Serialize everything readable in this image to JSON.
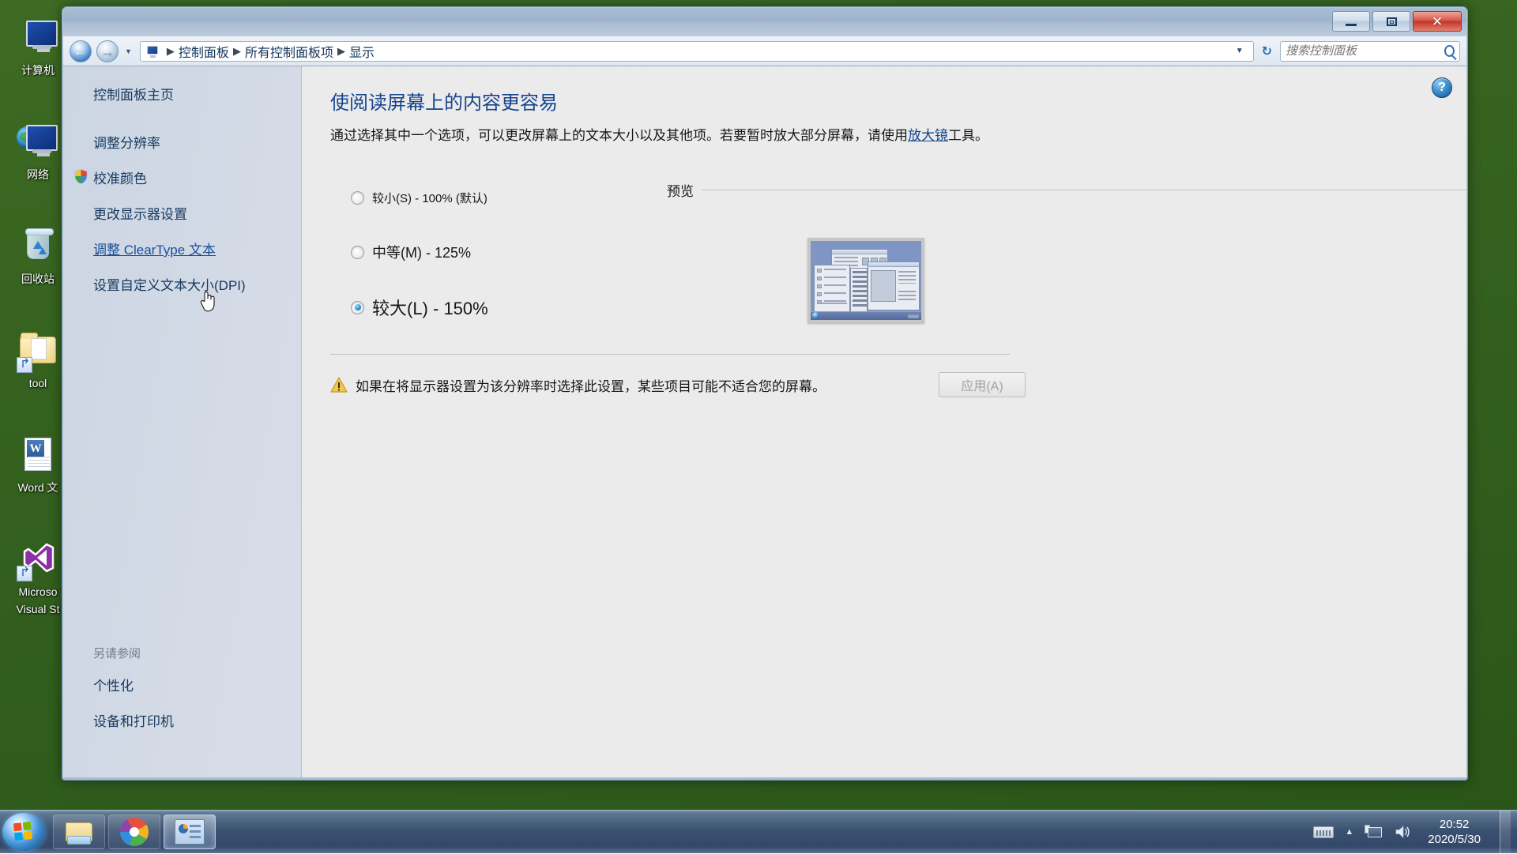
{
  "desktop": {
    "icons": [
      {
        "label": "计算机",
        "icon": "computer-icon"
      },
      {
        "label": "网络",
        "icon": "network-icon"
      },
      {
        "label": "回收站",
        "icon": "recycle-bin-icon"
      },
      {
        "label": "tool",
        "icon": "folder-shortcut-icon"
      },
      {
        "label": "Word 文",
        "icon": "word-document-icon"
      },
      {
        "label": "Microso",
        "label2": "Visual St",
        "icon": "visual-studio-icon"
      }
    ]
  },
  "window": {
    "nav": {
      "back_label": "←",
      "forward_label": "→",
      "history_dropdown": "▼",
      "breadcrumb": [
        "控制面板",
        "所有控制面板项",
        "显示"
      ],
      "breadcrumb_separator": "▶",
      "breadcrumb_dropdown": "▼",
      "refresh_label": "↻",
      "computer_icon": "computer-small-icon"
    },
    "search": {
      "placeholder": "搜索控制面板",
      "value": ""
    },
    "buttons": {
      "minimize": "—",
      "maximize": "❐",
      "close": "✕"
    },
    "help_label": "?"
  },
  "sidebar": {
    "home": "控制面板主页",
    "links": [
      {
        "label": "调整分辨率",
        "shield": false,
        "hovered": false
      },
      {
        "label": "校准颜色",
        "shield": true,
        "hovered": false
      },
      {
        "label": "更改显示器设置",
        "shield": false,
        "hovered": false
      },
      {
        "label": "调整 ClearType 文本",
        "shield": false,
        "hovered": true
      },
      {
        "label": "设置自定义文本大小(DPI)",
        "shield": false,
        "hovered": false
      }
    ],
    "see_also_title": "另请参阅",
    "see_also": [
      "个性化",
      "设备和打印机"
    ]
  },
  "content": {
    "title": "使阅读屏幕上的内容更容易",
    "desc_part1": "通过选择其中一个选项，可以更改屏幕上的文本大小以及其他项。若要暂时放大部分屏幕，请使用",
    "desc_link": "放大镜",
    "desc_part2": "工具。",
    "options": [
      {
        "label": "较小(S) - 100% (默认)",
        "selected": false,
        "scale": 100
      },
      {
        "label": "中等(M) - 125%",
        "selected": false,
        "scale": 125
      },
      {
        "label": "较大(L) - 150%",
        "selected": true,
        "scale": 150
      }
    ],
    "preview_title": "预览",
    "warning_text": "如果在将显示器设置为该分辨率时选择此设置，某些项目可能不适合您的屏幕。",
    "apply_label": "应用(A)",
    "apply_disabled": true
  },
  "taskbar": {
    "start_label": "开始",
    "buttons": [
      {
        "name": "file-explorer",
        "active": false
      },
      {
        "name": "browser",
        "active": false
      },
      {
        "name": "control-panel",
        "active": true
      }
    ],
    "tray": {
      "chevron": "▲"
    },
    "clock": {
      "time": "20:52",
      "date": "2020/5/30"
    }
  },
  "colors": {
    "accent": "#16458f",
    "link": "#1a4f96",
    "desktop": "#35621f",
    "sidebar": "#d2d9e5",
    "content": "#ebebeb"
  }
}
